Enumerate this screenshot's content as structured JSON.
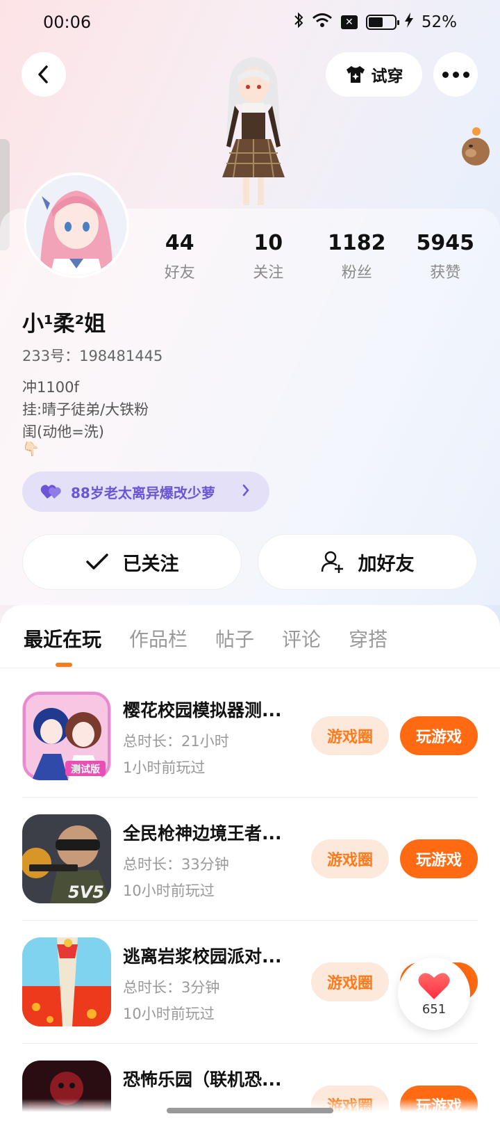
{
  "status_bar": {
    "time": "00:06",
    "battery": "52%"
  },
  "header": {
    "tryon_label": "试穿"
  },
  "profile": {
    "stats": [
      {
        "value": "44",
        "label": "好友"
      },
      {
        "value": "10",
        "label": "关注"
      },
      {
        "value": "1182",
        "label": "粉丝"
      },
      {
        "value": "5945",
        "label": "获赞"
      }
    ],
    "username": "小¹柔²姐",
    "user_id": "233号：198481445",
    "bio_lines": [
      "冲1100f",
      "挂:晴子徒弟/大铁粉",
      "闺(动他=洗)"
    ],
    "bio_emoji": "👇🏻",
    "tag": "88岁老太离异爆改少萝",
    "follow_label": "已关注",
    "add_friend_label": "加好友"
  },
  "tabs": [
    "最近在玩",
    "作品栏",
    "帖子",
    "评论",
    "穿搭"
  ],
  "games": [
    {
      "title": "樱花校园模拟器测...",
      "duration": "总时长：21小时",
      "last_played": "1小时前玩过",
      "icon": "sakura-school-game-icon",
      "icon_badge": "测试版"
    },
    {
      "title": "全民枪神边境王者...",
      "duration": "总时长：33分钟",
      "last_played": "10小时前玩过",
      "icon": "gun-shooter-game-icon",
      "icon_badge": "5V5"
    },
    {
      "title": "逃离岩浆校园派对...",
      "duration": "总时长：3分钟",
      "last_played": "10小时前玩过",
      "icon": "lava-escape-game-icon"
    },
    {
      "title": "恐怖乐园（联机恐...",
      "duration": "",
      "last_played": "",
      "icon": "horror-park-game-icon"
    }
  ],
  "game_buttons": {
    "circle_label": "游戏圈",
    "play_label": "玩游戏"
  },
  "like_fab": {
    "count": "651"
  },
  "colors": {
    "accent_orange": "#ff6a12",
    "tag_purple": "#6b55d6"
  }
}
